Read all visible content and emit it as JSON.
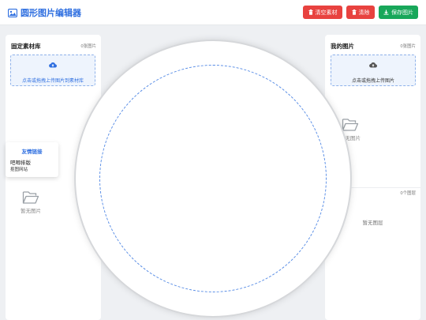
{
  "header": {
    "title": "圆形图片编辑器",
    "title_icon": "image-icon",
    "buttons": {
      "clear_material": "清空素材",
      "clear": "清除",
      "save": "保存图片"
    },
    "colors": {
      "accent": "#2f6fe0",
      "danger": "#e8423f",
      "success": "#18a75a"
    }
  },
  "left_panel": {
    "title": "固定素材库",
    "count": "0张图片",
    "upload_text": "点击或拖拽上传图片到素材库",
    "upload_icon": "cloud-upload-icon",
    "empty_text": "暂无图片",
    "empty_icon": "folder-open-icon"
  },
  "right_panel": {
    "title": "我的图片",
    "count": "0张图片",
    "upload_text": "点击或拖拽上传图片",
    "upload_icon": "cloud-upload-icon",
    "empty_text": "暂无图片",
    "empty_icon": "folder-open-icon",
    "layers_count": "0个图层",
    "layers_empty": "暂无图层"
  },
  "friend_links": {
    "title": "友情链接",
    "items": [
      "吧唧排版",
      "抠图网站"
    ]
  }
}
